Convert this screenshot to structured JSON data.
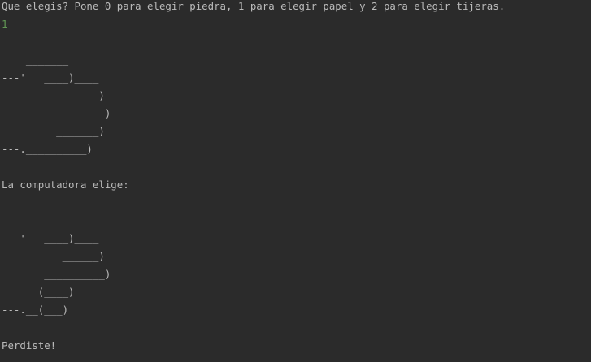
{
  "console": {
    "prompt": "Que elegis? Pone 0 para elegir piedra, 1 para elegir papel y 2 para elegir tijeras.",
    "user_input": "1",
    "input_color": "#629755",
    "text_color": "#bbbbbb",
    "background_color": "#2b2b2b",
    "user_art": [
      "    _______",
      "---'   ____)____",
      "          ______)",
      "          _______)",
      "         _______)",
      "---.__________)"
    ],
    "computer_label": "La computadora elige:",
    "computer_art": [
      "    _______",
      "---'   ____)____",
      "          ______)",
      "       __________)",
      "      (____)",
      "---.__(___)"
    ],
    "result": "Perdiste!"
  }
}
